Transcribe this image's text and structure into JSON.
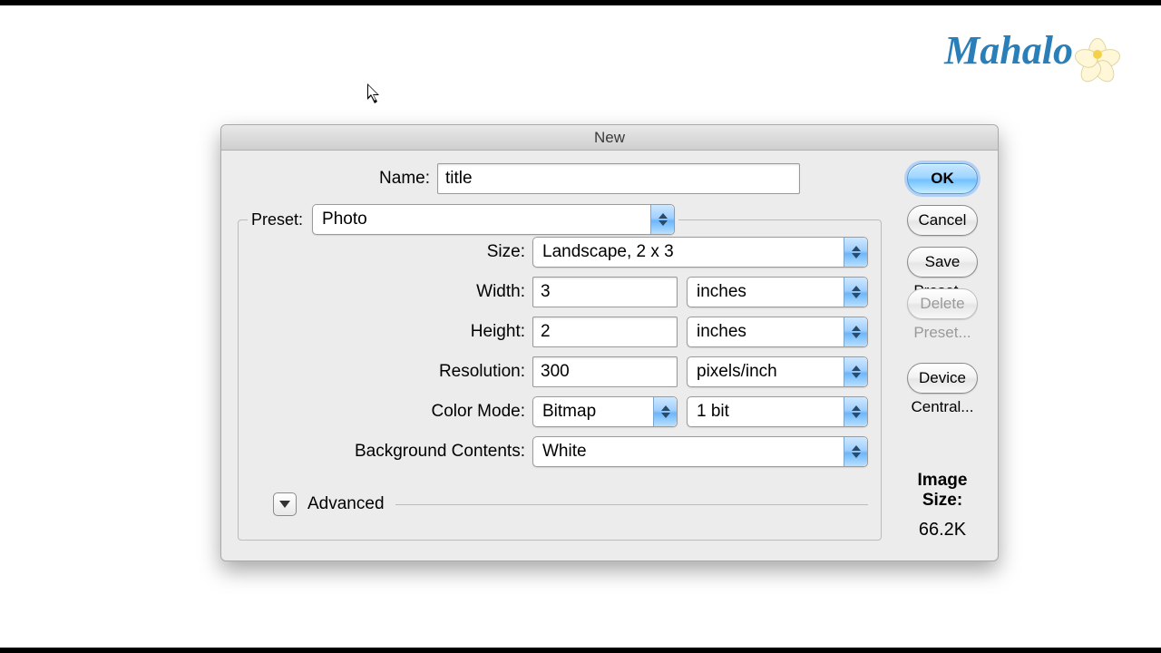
{
  "watermark": {
    "text": "Mahalo"
  },
  "dialog": {
    "title": "New",
    "name": {
      "label": "Name:",
      "value": "title"
    },
    "preset": {
      "label": "Preset:",
      "value": "Photo"
    },
    "size": {
      "label": "Size:",
      "value": "Landscape, 2 x 3"
    },
    "width": {
      "label": "Width:",
      "value": "3",
      "unit": "inches"
    },
    "height": {
      "label": "Height:",
      "value": "2",
      "unit": "inches"
    },
    "resolution": {
      "label": "Resolution:",
      "value": "300",
      "unit": "pixels/inch"
    },
    "color_mode": {
      "label": "Color Mode:",
      "value": "Bitmap",
      "depth": "1 bit"
    },
    "background": {
      "label": "Background Contents:",
      "value": "White"
    },
    "advanced": {
      "label": "Advanced"
    },
    "image_size": {
      "label": "Image Size:",
      "value": "66.2K"
    },
    "buttons": {
      "ok": "OK",
      "cancel": "Cancel",
      "save_preset": "Save Preset...",
      "delete_preset": "Delete Preset...",
      "device_central": "Device Central..."
    }
  }
}
